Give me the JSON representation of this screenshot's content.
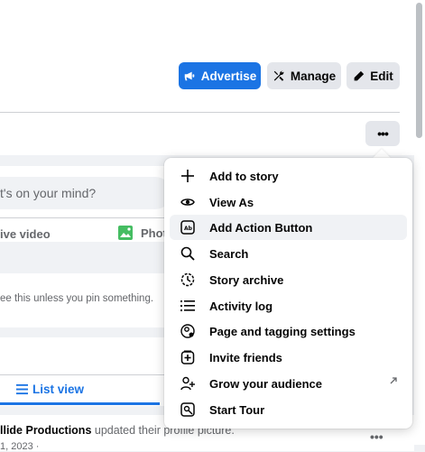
{
  "header": {
    "advertise_label": "Advertise",
    "manage_label": "Manage",
    "edit_label": "Edit",
    "more_label": "•••"
  },
  "composer": {
    "placeholder": "t's on your mind?",
    "live_video_label": "ive video",
    "photo_label": "Phot"
  },
  "pinned": {
    "text": "ee this unless you pin something."
  },
  "views": {
    "list_view_label": "List view"
  },
  "post": {
    "author": "llide Productions",
    "action": " updated their profile picture.",
    "date": "1, 2023 ·",
    "more_label": "•••"
  },
  "menu": {
    "items": [
      {
        "label": "Add to story",
        "icon": "plus-icon"
      },
      {
        "label": "View As",
        "icon": "eye-icon"
      },
      {
        "label": "Add Action Button",
        "icon": "action-button-icon"
      },
      {
        "label": "Search",
        "icon": "search-icon"
      },
      {
        "label": "Story archive",
        "icon": "archive-clock-icon"
      },
      {
        "label": "Activity log",
        "icon": "list-icon"
      },
      {
        "label": "Page and tagging settings",
        "icon": "settings-person-icon"
      },
      {
        "label": "Invite friends",
        "icon": "invite-icon"
      },
      {
        "label": "Grow your audience",
        "icon": "add-person-icon"
      },
      {
        "label": "Start Tour",
        "icon": "tour-icon"
      }
    ],
    "highlighted_item": "Add Action Button"
  },
  "colors": {
    "accent": "#1b74e4",
    "button_gray": "#e4e6eb",
    "background": "#f0f2f5"
  }
}
